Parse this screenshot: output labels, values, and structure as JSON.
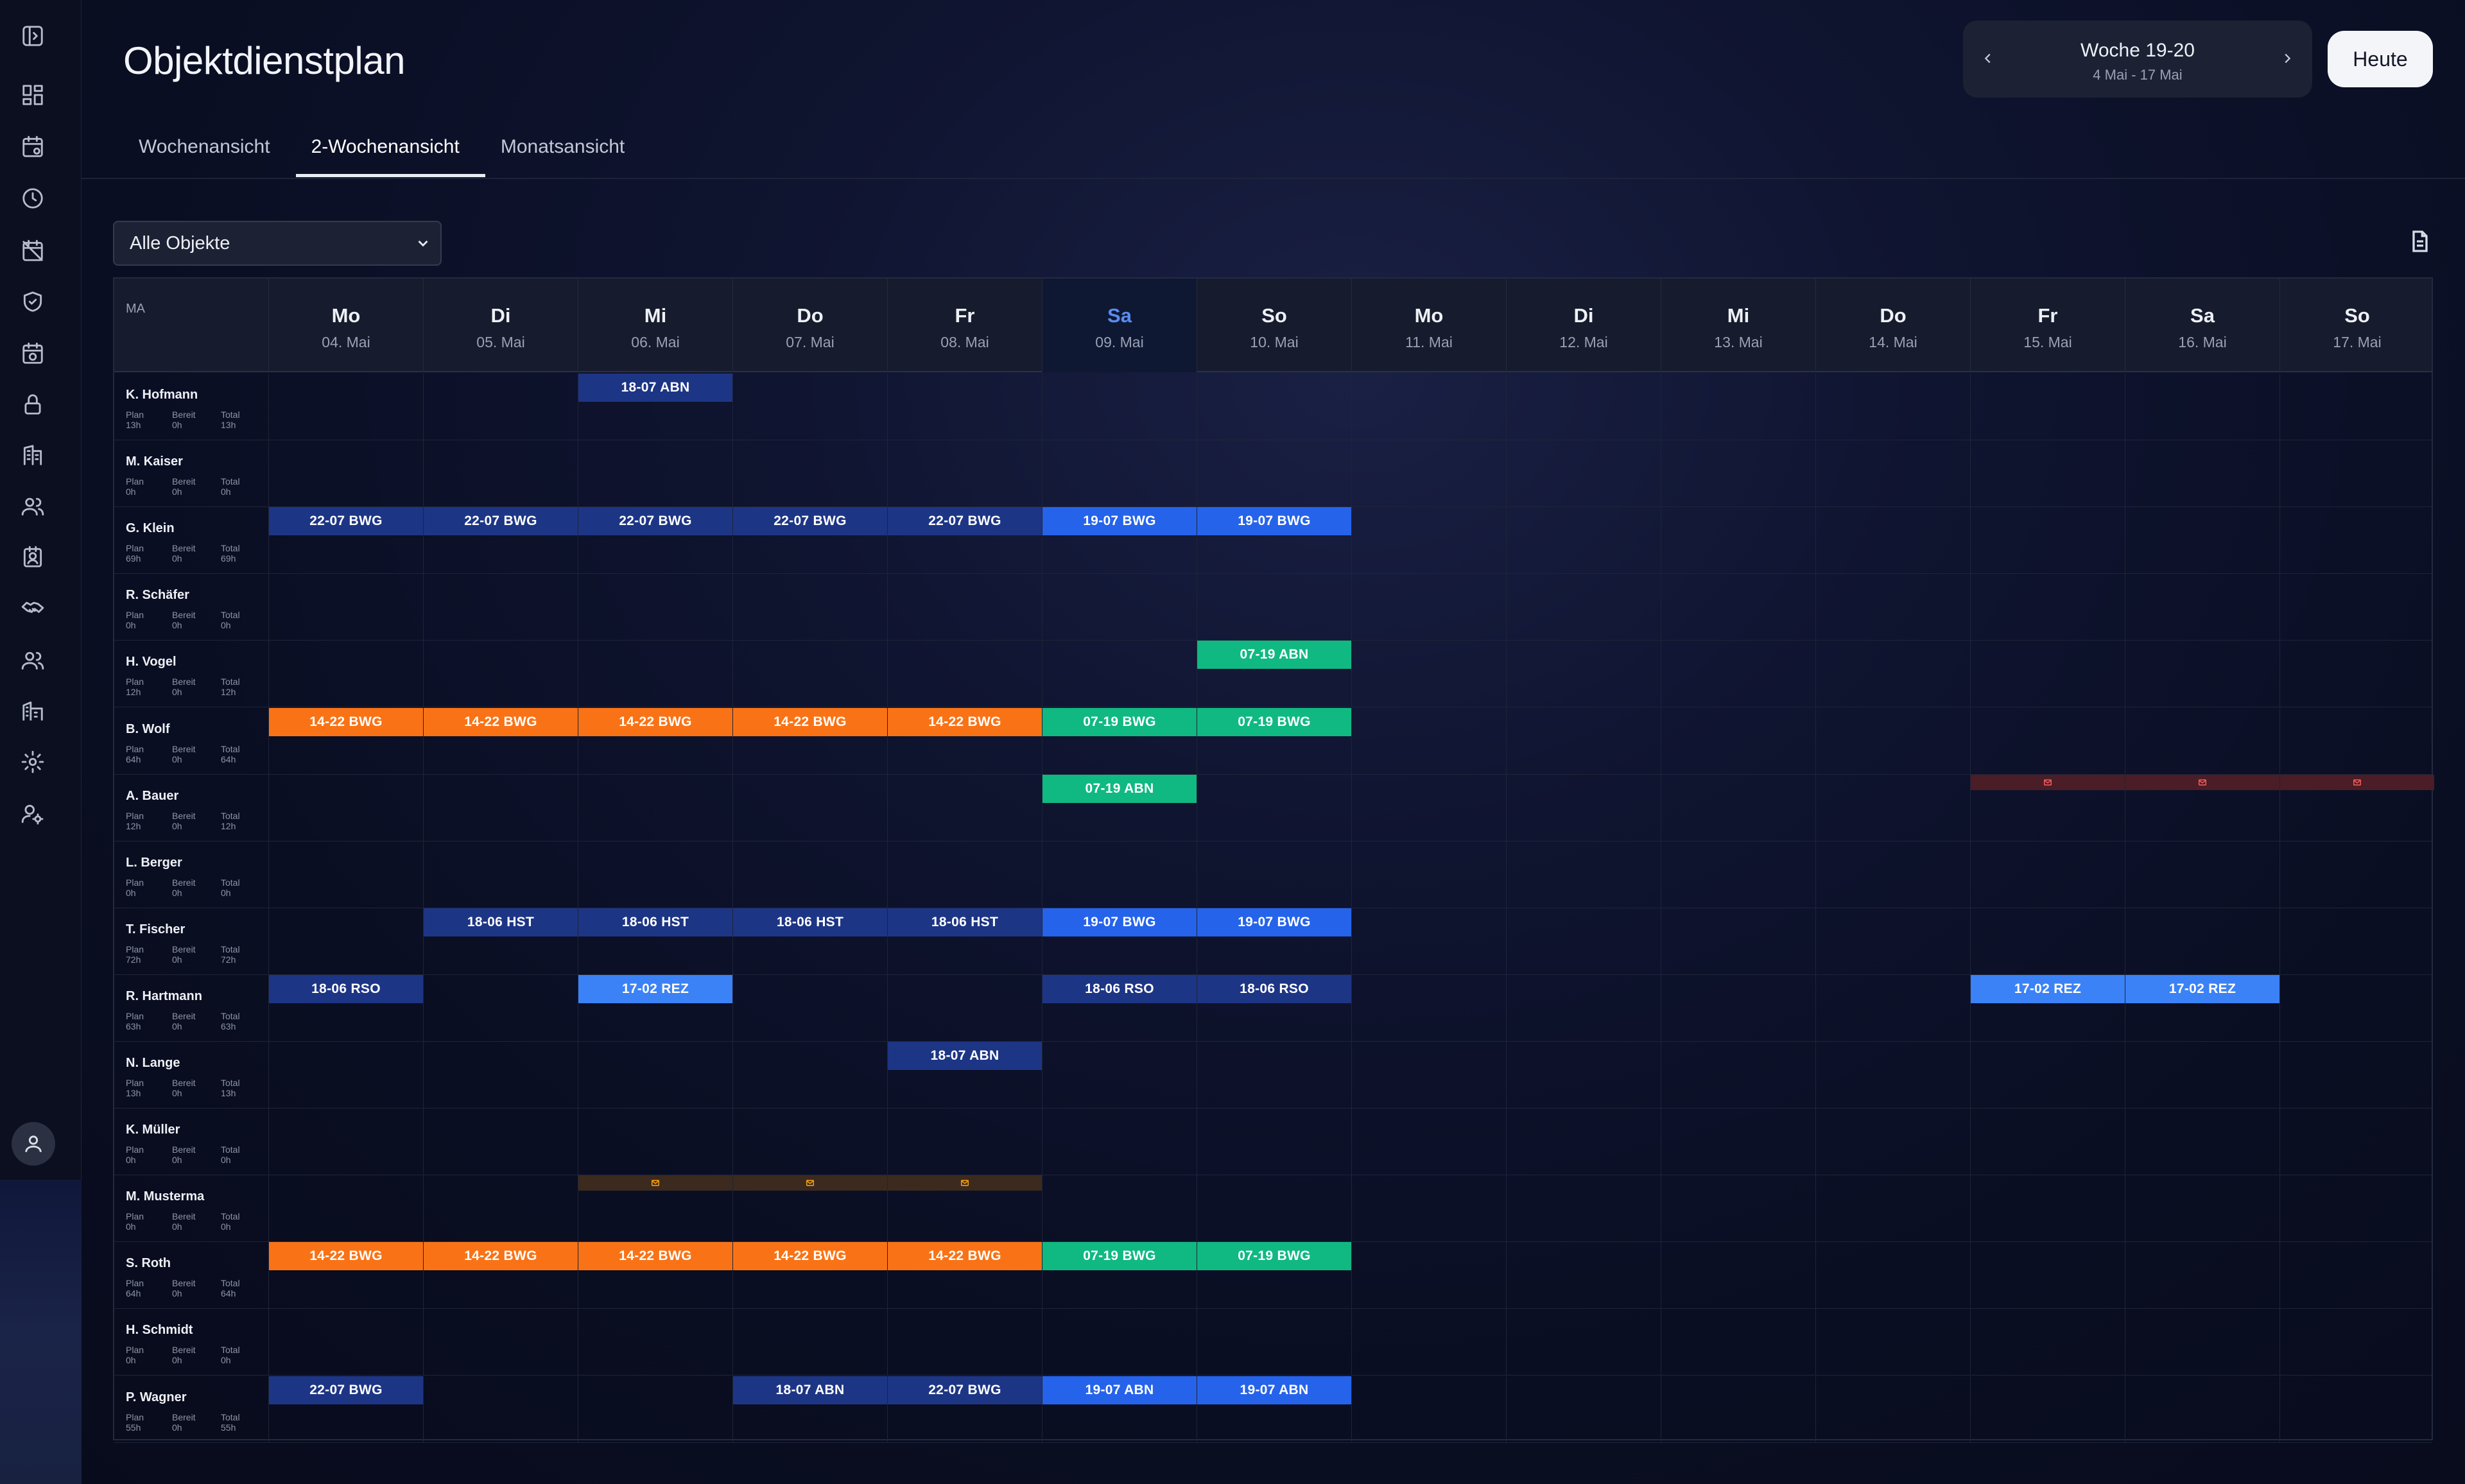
{
  "page": {
    "title": "Objektdienstplan"
  },
  "tabs": [
    {
      "label": "Wochenansicht"
    },
    {
      "label": "2-Wochenansicht",
      "active": true
    },
    {
      "label": "Monatsansicht"
    }
  ],
  "week_nav": {
    "title": "Woche 19-20",
    "range": "4 Mai - 17 Mai",
    "today_label": "Heute"
  },
  "filter": {
    "selected": "Alle Objekte"
  },
  "sidebar": {
    "icons": [
      "sidebar-toggle-icon",
      "dashboard-icon",
      "calendar-settings-icon",
      "clock-icon",
      "calendar-off-icon",
      "shield-check-icon",
      "calendar-clock-icon",
      "lock-icon",
      "building-icon",
      "users-icon",
      "contact-card-icon",
      "handshake-icon",
      "team-icon",
      "buildings-icon",
      "gear-icon",
      "user-settings-icon"
    ]
  },
  "grid": {
    "ma_label": "MA",
    "days": [
      {
        "name": "Mo",
        "date": "04. Mai"
      },
      {
        "name": "Di",
        "date": "05. Mai"
      },
      {
        "name": "Mi",
        "date": "06. Mai"
      },
      {
        "name": "Do",
        "date": "07. Mai"
      },
      {
        "name": "Fr",
        "date": "08. Mai"
      },
      {
        "name": "Sa",
        "date": "09. Mai",
        "highlight": true
      },
      {
        "name": "So",
        "date": "10. Mai"
      },
      {
        "name": "Mo",
        "date": "11. Mai"
      },
      {
        "name": "Di",
        "date": "12. Mai"
      },
      {
        "name": "Mi",
        "date": "13. Mai"
      },
      {
        "name": "Do",
        "date": "14. Mai"
      },
      {
        "name": "Fr",
        "date": "15. Mai"
      },
      {
        "name": "Sa",
        "date": "16. Mai"
      },
      {
        "name": "So",
        "date": "17. Mai"
      }
    ],
    "labels": {
      "plan": "Plan",
      "bereit": "Bereit",
      "total": "Total"
    },
    "employees": [
      {
        "name": "K. Hofmann",
        "plan": "13h",
        "bereit": "0h",
        "total": "13h",
        "shifts": [
          {
            "day": 2,
            "text": "18-07 ABN",
            "color": "navy"
          }
        ]
      },
      {
        "name": "M. Kaiser",
        "plan": "0h",
        "bereit": "0h",
        "total": "0h",
        "shifts": []
      },
      {
        "name": "G. Klein",
        "plan": "69h",
        "bereit": "0h",
        "total": "69h",
        "shifts": [
          {
            "day": 0,
            "text": "22-07 BWG",
            "color": "navy"
          },
          {
            "day": 1,
            "text": "22-07 BWG",
            "color": "navy"
          },
          {
            "day": 2,
            "text": "22-07 BWG",
            "color": "navy"
          },
          {
            "day": 3,
            "text": "22-07 BWG",
            "color": "navy"
          },
          {
            "day": 4,
            "text": "22-07 BWG",
            "color": "navy"
          },
          {
            "day": 5,
            "text": "19-07 BWG",
            "color": "blue"
          },
          {
            "day": 6,
            "text": "19-07 BWG",
            "color": "blue"
          }
        ]
      },
      {
        "name": "R. Schäfer",
        "plan": "0h",
        "bereit": "0h",
        "total": "0h",
        "shifts": []
      },
      {
        "name": "H. Vogel",
        "plan": "12h",
        "bereit": "0h",
        "total": "12h",
        "shifts": [
          {
            "day": 6,
            "text": "07-19 ABN",
            "color": "green"
          }
        ]
      },
      {
        "name": "B. Wolf",
        "plan": "64h",
        "bereit": "0h",
        "total": "64h",
        "shifts": [
          {
            "day": 0,
            "text": "14-22 BWG",
            "color": "orange"
          },
          {
            "day": 1,
            "text": "14-22 BWG",
            "color": "orange"
          },
          {
            "day": 2,
            "text": "14-22 BWG",
            "color": "orange"
          },
          {
            "day": 3,
            "text": "14-22 BWG",
            "color": "orange"
          },
          {
            "day": 4,
            "text": "14-22 BWG",
            "color": "orange"
          },
          {
            "day": 5,
            "text": "07-19 BWG",
            "color": "green"
          },
          {
            "day": 6,
            "text": "07-19 BWG",
            "color": "green"
          }
        ]
      },
      {
        "name": "A. Bauer",
        "plan": "12h",
        "bereit": "0h",
        "total": "12h",
        "shifts": [
          {
            "day": 5,
            "text": "07-19 ABN",
            "color": "green"
          }
        ],
        "absences": [
          {
            "day": 11,
            "color": "red"
          },
          {
            "day": 12,
            "color": "red"
          },
          {
            "day": 13,
            "color": "red"
          }
        ]
      },
      {
        "name": "L. Berger",
        "plan": "0h",
        "bereit": "0h",
        "total": "0h",
        "shifts": []
      },
      {
        "name": "T. Fischer",
        "plan": "72h",
        "bereit": "0h",
        "total": "72h",
        "shifts": [
          {
            "day": 1,
            "text": "18-06 HST",
            "color": "navy"
          },
          {
            "day": 2,
            "text": "18-06 HST",
            "color": "navy"
          },
          {
            "day": 3,
            "text": "18-06 HST",
            "color": "navy"
          },
          {
            "day": 4,
            "text": "18-06 HST",
            "color": "navy"
          },
          {
            "day": 5,
            "text": "19-07 BWG",
            "color": "blue"
          },
          {
            "day": 6,
            "text": "19-07 BWG",
            "color": "blue"
          }
        ]
      },
      {
        "name": "R. Hartmann",
        "plan": "63h",
        "bereit": "0h",
        "total": "63h",
        "shifts": [
          {
            "day": 0,
            "text": "18-06 RSO",
            "color": "navy"
          },
          {
            "day": 2,
            "text": "17-02 REZ",
            "color": "lightblue"
          },
          {
            "day": 5,
            "text": "18-06 RSO",
            "color": "navy"
          },
          {
            "day": 6,
            "text": "18-06 RSO",
            "color": "navy"
          },
          {
            "day": 11,
            "text": "17-02 REZ",
            "color": "lightblue"
          },
          {
            "day": 12,
            "text": "17-02 REZ",
            "color": "lightblue"
          }
        ]
      },
      {
        "name": "N. Lange",
        "plan": "13h",
        "bereit": "0h",
        "total": "13h",
        "shifts": [
          {
            "day": 4,
            "text": "18-07 ABN",
            "color": "navy"
          }
        ]
      },
      {
        "name": "K. Müller",
        "plan": "0h",
        "bereit": "0h",
        "total": "0h",
        "shifts": []
      },
      {
        "name": "M. Musterma",
        "plan": "0h",
        "bereit": "0h",
        "total": "0h",
        "shifts": [],
        "absences": [
          {
            "day": 2,
            "color": "brown"
          },
          {
            "day": 3,
            "color": "brown"
          },
          {
            "day": 4,
            "color": "brown"
          }
        ]
      },
      {
        "name": "S. Roth",
        "plan": "64h",
        "bereit": "0h",
        "total": "64h",
        "shifts": [
          {
            "day": 0,
            "text": "14-22 BWG",
            "color": "orange"
          },
          {
            "day": 1,
            "text": "14-22 BWG",
            "color": "orange"
          },
          {
            "day": 2,
            "text": "14-22 BWG",
            "color": "orange"
          },
          {
            "day": 3,
            "text": "14-22 BWG",
            "color": "orange"
          },
          {
            "day": 4,
            "text": "14-22 BWG",
            "color": "orange"
          },
          {
            "day": 5,
            "text": "07-19 BWG",
            "color": "green"
          },
          {
            "day": 6,
            "text": "07-19 BWG",
            "color": "green"
          }
        ]
      },
      {
        "name": "H. Schmidt",
        "plan": "0h",
        "bereit": "0h",
        "total": "0h",
        "shifts": []
      },
      {
        "name": "P. Wagner",
        "plan": "55h",
        "bereit": "0h",
        "total": "55h",
        "shifts": [
          {
            "day": 0,
            "text": "22-07 BWG",
            "color": "navy"
          },
          {
            "day": 3,
            "text": "18-07 ABN",
            "color": "navy"
          },
          {
            "day": 4,
            "text": "22-07 BWG",
            "color": "navy"
          },
          {
            "day": 5,
            "text": "19-07 ABN",
            "color": "blue"
          },
          {
            "day": 6,
            "text": "19-07 ABN",
            "color": "blue"
          }
        ]
      }
    ]
  }
}
